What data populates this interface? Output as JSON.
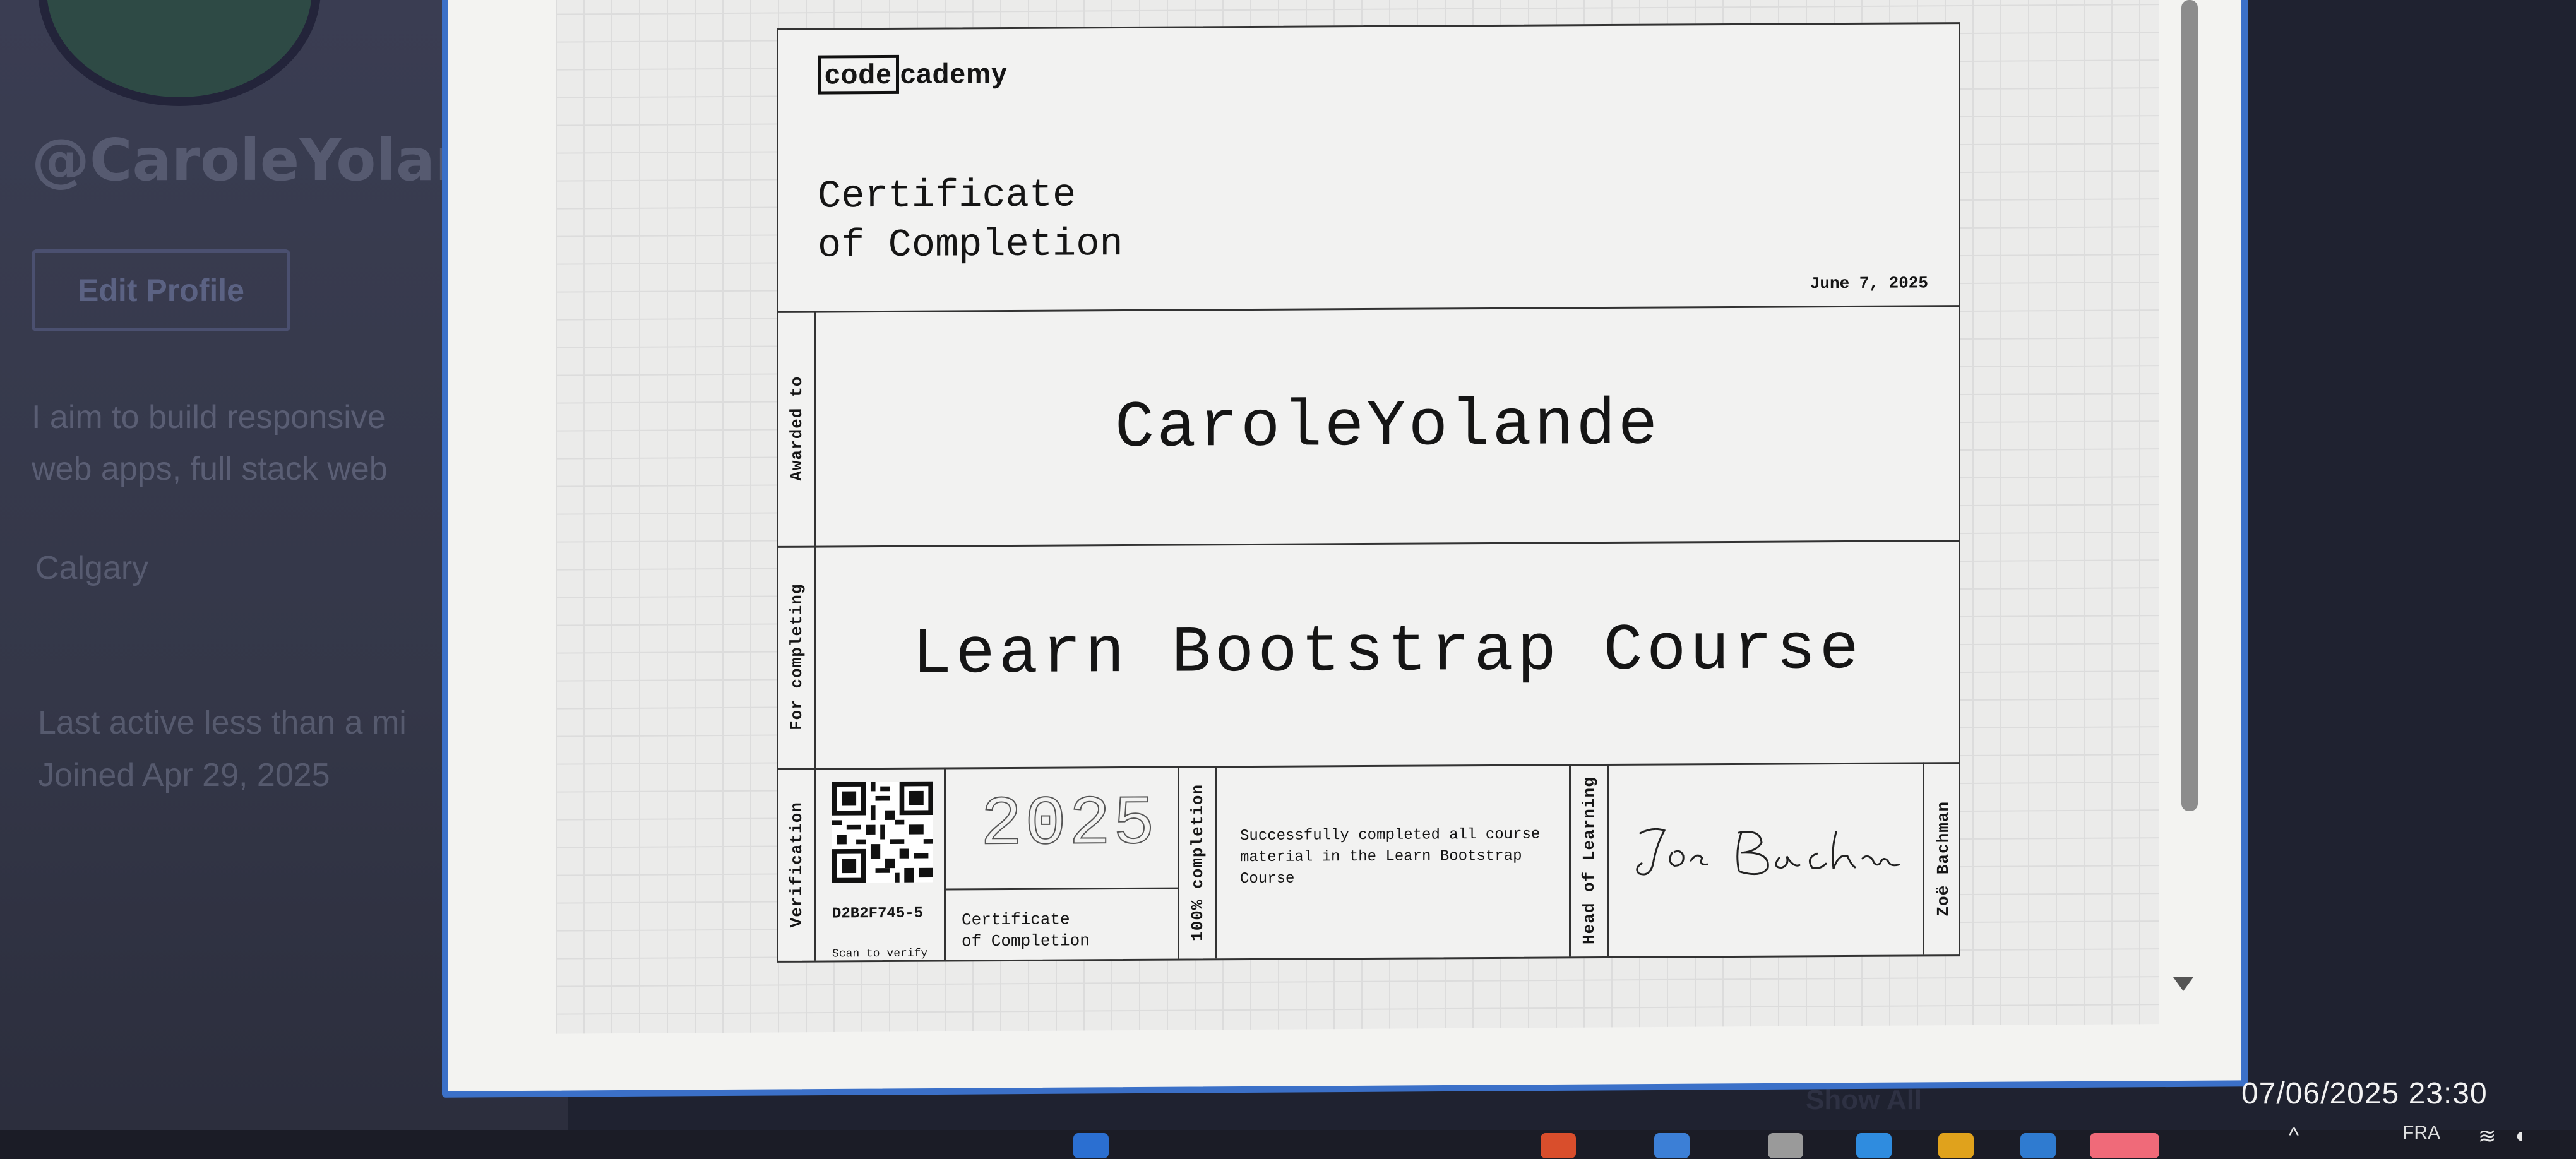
{
  "profile": {
    "handle": "@CaroleYoland",
    "edit_label": "Edit Profile",
    "bio_line1": "I aim to build responsive",
    "bio_line2": "web apps, full stack web",
    "city": "Calgary",
    "last_active": "Last active less than a mi",
    "joined": "Joined Apr 29, 2025"
  },
  "certificate": {
    "logo_box": "code",
    "logo_rest": "cademy",
    "title": "Certificate\nof Completion",
    "date": "June 7, 2025",
    "awarded_label": "Awarded to",
    "recipient": "CaroleYolande",
    "completing_label": "For completing",
    "course": "Learn Bootstrap Course",
    "verification_label": "Verification",
    "credential_id": "D2B2F745-5",
    "scan_label": "Scan to verify",
    "year": "2025",
    "small_title": "Certificate\nof Completion",
    "completion_label": "100% completion",
    "description": "Successfully completed all course material in the Learn Bootstrap Course",
    "head_label": "Head of Learning",
    "signer": "Zoë Bachman"
  },
  "overlay": {
    "show_all": "Show All",
    "clock": "07/06/2025 23:30",
    "lang": "FRA"
  },
  "colors": {
    "modal_border": "#3b70c8",
    "background": "#1f2230"
  }
}
